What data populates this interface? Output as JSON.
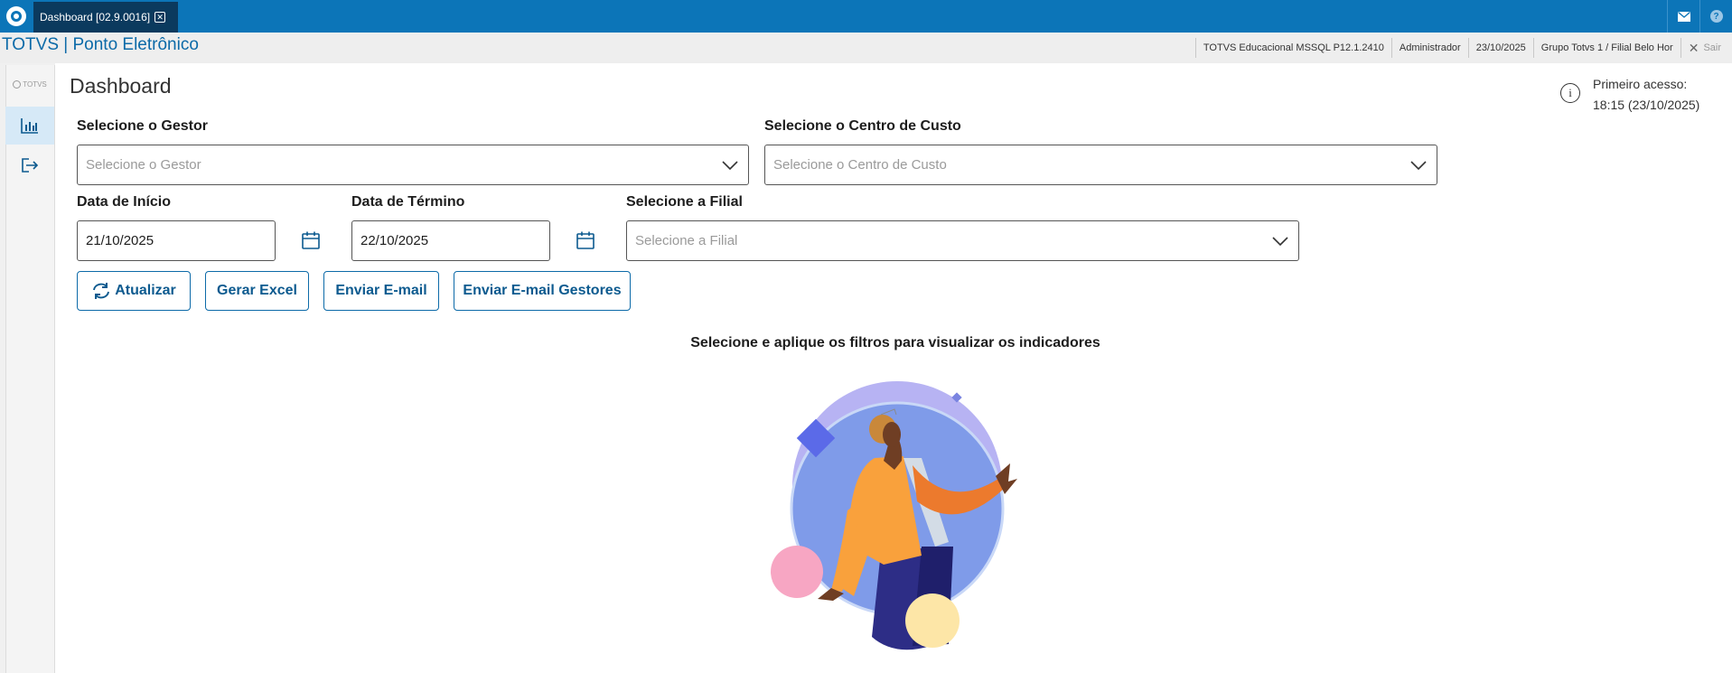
{
  "topbar": {
    "tab_label": "Dashboard [02.9.0016]",
    "mail_icon": "mail-icon",
    "help_icon": "help-icon",
    "accent": "#0c75b8"
  },
  "subbar": {
    "app_title": "TOTVS | Ponto Eletrônico",
    "items": [
      "TOTVS Educacional MSSQL P12.1.2410",
      "Administrador",
      "23/10/2025",
      "Grupo Totvs 1 / Filial Belo Hor"
    ],
    "logout_label": "Sair"
  },
  "sidebar": {
    "brand": "TOTVS",
    "items": [
      {
        "icon": "bar-chart-icon",
        "active": true
      },
      {
        "icon": "exit-icon",
        "active": false
      }
    ]
  },
  "main": {
    "title": "Dashboard",
    "first_access_label": "Primeiro acesso:",
    "first_access_value": "18:15 (23/10/2025)",
    "gestor": {
      "label": "Selecione o Gestor",
      "placeholder": "Selecione o Gestor"
    },
    "centro_custo": {
      "label": "Selecione o Centro de Custo",
      "placeholder": "Selecione o Centro de Custo"
    },
    "data_inicio": {
      "label": "Data de Início",
      "value": "21/10/2025"
    },
    "data_termino": {
      "label": "Data de Término",
      "value": "22/10/2025"
    },
    "filial": {
      "label": "Selecione a Filial",
      "placeholder": "Selecione a Filial"
    },
    "buttons": {
      "atualizar": "Atualizar",
      "gerar_excel": "Gerar Excel",
      "enviar_email": "Enviar E-mail",
      "enviar_email_gestores": "Enviar E-mail Gestores"
    },
    "empty_message": "Selecione e aplique os filtros para visualizar os indicadores"
  }
}
